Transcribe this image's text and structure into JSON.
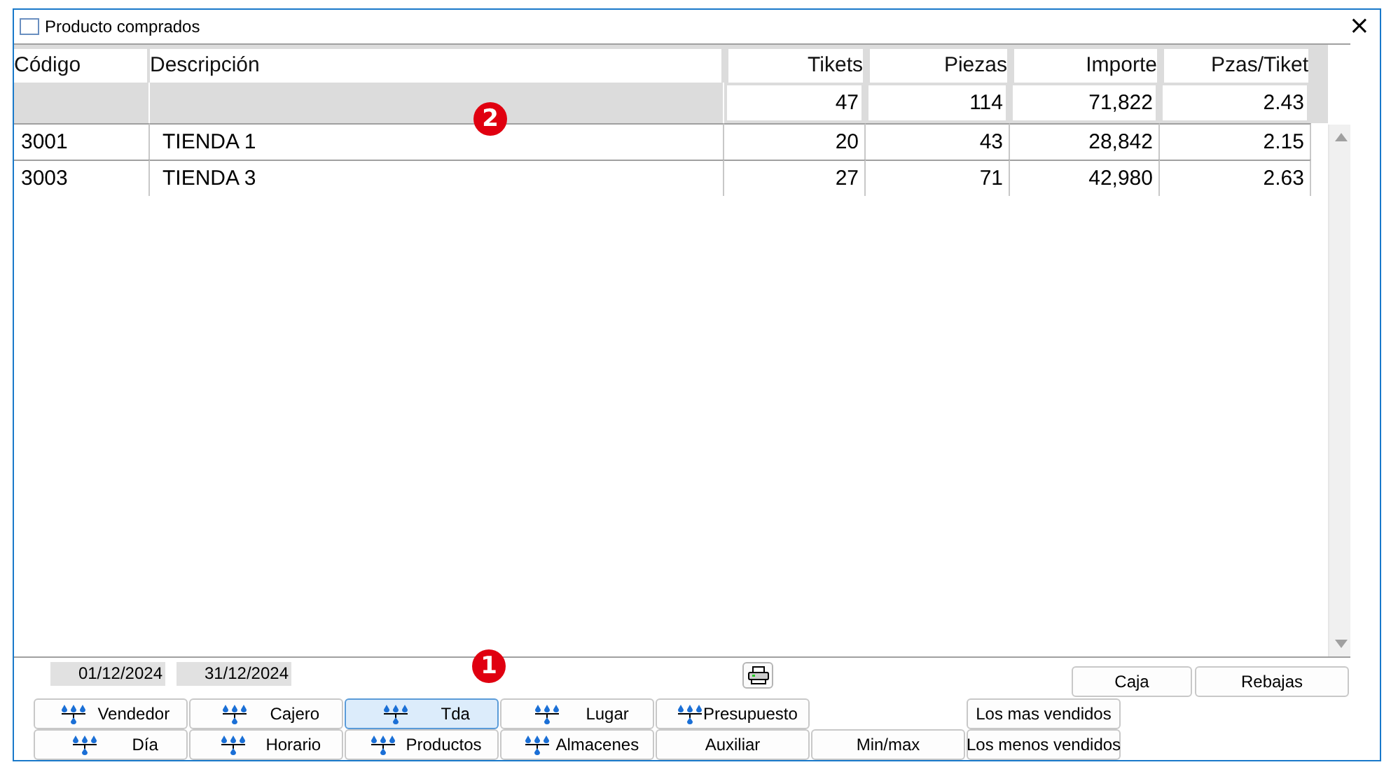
{
  "window": {
    "title": "Producto comprados",
    "close": "×"
  },
  "table": {
    "columns": [
      "Código",
      "Descripción",
      "Tikets",
      "Piezas",
      "Importe",
      "Pzas/Tiket"
    ],
    "totals": [
      "47",
      "114",
      "71,822",
      "2.43"
    ],
    "rows": [
      [
        "3001",
        "TIENDA 1",
        "20",
        "43",
        "28,842",
        "2.15"
      ],
      [
        "3003",
        "TIENDA 3",
        "27",
        "71",
        "42,980",
        "2.63"
      ]
    ]
  },
  "dates": [
    "01/12/2024",
    "31/12/2024"
  ],
  "side_buttons": [
    "Caja",
    "Rebajas"
  ],
  "button_rows": [
    [
      {
        "kind": "group",
        "label": "Vendedor",
        "selected": false
      },
      {
        "kind": "group",
        "label": "Cajero",
        "selected": false
      },
      {
        "kind": "group",
        "label": "Tda",
        "selected": true
      },
      {
        "kind": "group",
        "label": "Lugar",
        "selected": false
      },
      {
        "kind": "group",
        "label": "Presupuesto",
        "selected": false
      },
      {
        "kind": "gap"
      },
      {
        "kind": "plain",
        "label": "Los mas vendidos",
        "selected": false
      }
    ],
    [
      {
        "kind": "group",
        "label": "Día",
        "selected": false
      },
      {
        "kind": "group",
        "label": "Horario",
        "selected": false
      },
      {
        "kind": "group",
        "label": "Productos",
        "selected": false
      },
      {
        "kind": "group",
        "label": "Almacenes",
        "selected": false
      },
      {
        "kind": "plain",
        "label": "Auxiliar",
        "selected": false
      },
      {
        "kind": "plain",
        "label": "Min/max",
        "selected": false
      },
      {
        "kind": "plain",
        "label": "Los menos vendidos",
        "selected": false
      }
    ]
  ],
  "annotations": [
    "2",
    "1"
  ]
}
